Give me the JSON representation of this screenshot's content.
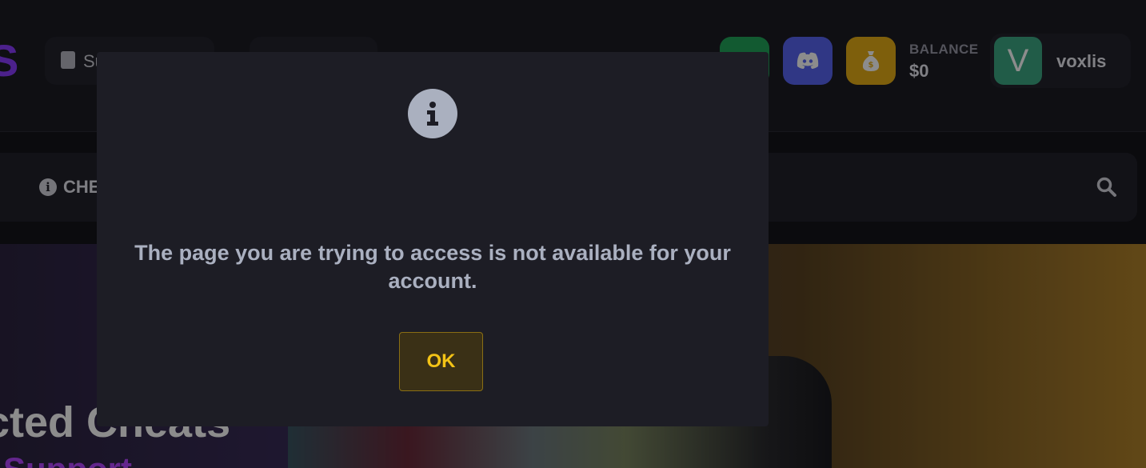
{
  "header": {
    "support_label": "Su",
    "balance_label": "BALANCE",
    "balance_value": "$0",
    "user": {
      "avatar_letter": "V",
      "username": "voxlis"
    },
    "icons": {
      "green_button": "green-square-icon",
      "discord_button": "discord-icon",
      "money_button": "money-bag-icon"
    }
  },
  "nav": {
    "cheats_label": "CHE",
    "search_icon": "search-icon"
  },
  "hero": {
    "title": "cted Cheats",
    "subtitle": "Support"
  },
  "modal": {
    "icon": "info-icon",
    "message": "The page you are trying to access is not available for your account.",
    "ok_label": "OK"
  },
  "colors": {
    "accent_yellow": "#f3c316",
    "discord": "#5865f2",
    "money": "#e6ad16",
    "avatar": "#3ca884",
    "brand_purple": "#8a3cff"
  }
}
